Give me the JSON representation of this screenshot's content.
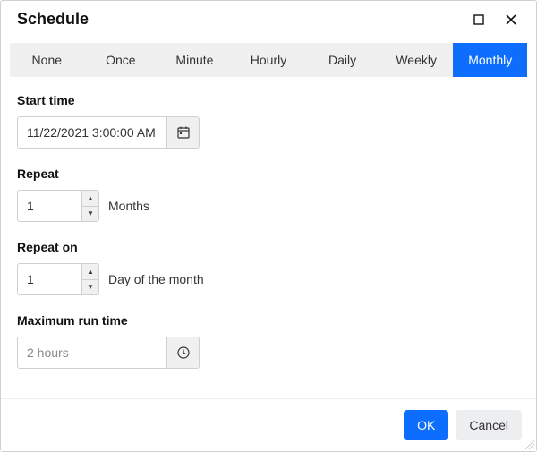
{
  "dialog": {
    "title": "Schedule"
  },
  "tabs": {
    "items": [
      "None",
      "Once",
      "Minute",
      "Hourly",
      "Daily",
      "Weekly",
      "Monthly"
    ],
    "active_index": 6
  },
  "fields": {
    "start_time": {
      "label": "Start time",
      "value": "11/22/2021 3:00:00 AM"
    },
    "repeat": {
      "label": "Repeat",
      "value": "1",
      "unit": "Months"
    },
    "repeat_on": {
      "label": "Repeat on",
      "value": "1",
      "unit": "Day of the month"
    },
    "max_run": {
      "label": "Maximum run time",
      "placeholder": "2 hours"
    }
  },
  "footer": {
    "ok": "OK",
    "cancel": "Cancel"
  }
}
